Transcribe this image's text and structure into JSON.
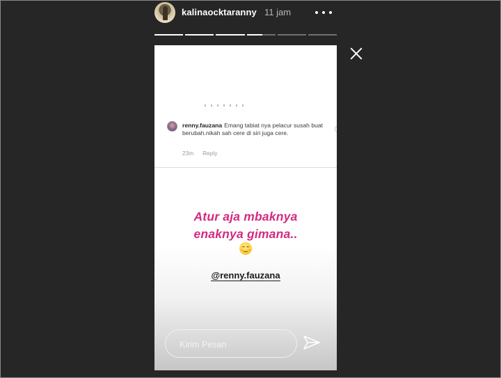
{
  "header": {
    "username": "kalinaocktaranny",
    "time": "11 jam"
  },
  "progress": [
    1,
    1,
    1,
    0.55,
    0,
    0
  ],
  "story": {
    "comment": {
      "user": "renny.fauzana",
      "text": "Emang tabiat nya pelacur susah buat berubah.nikah sah cere di siri juga cere.",
      "age": "23m",
      "reply_label": "Reply"
    },
    "sticker_line1": "Atur aja mbaknya",
    "sticker_line2": "enaknya gimana..",
    "emoji": "smiling-face-icon",
    "mention": "@renny.fauzana"
  },
  "reply": {
    "placeholder": "Kirim Pesan"
  },
  "colors": {
    "background": "#262626",
    "sticker_text": "#d42a80"
  }
}
